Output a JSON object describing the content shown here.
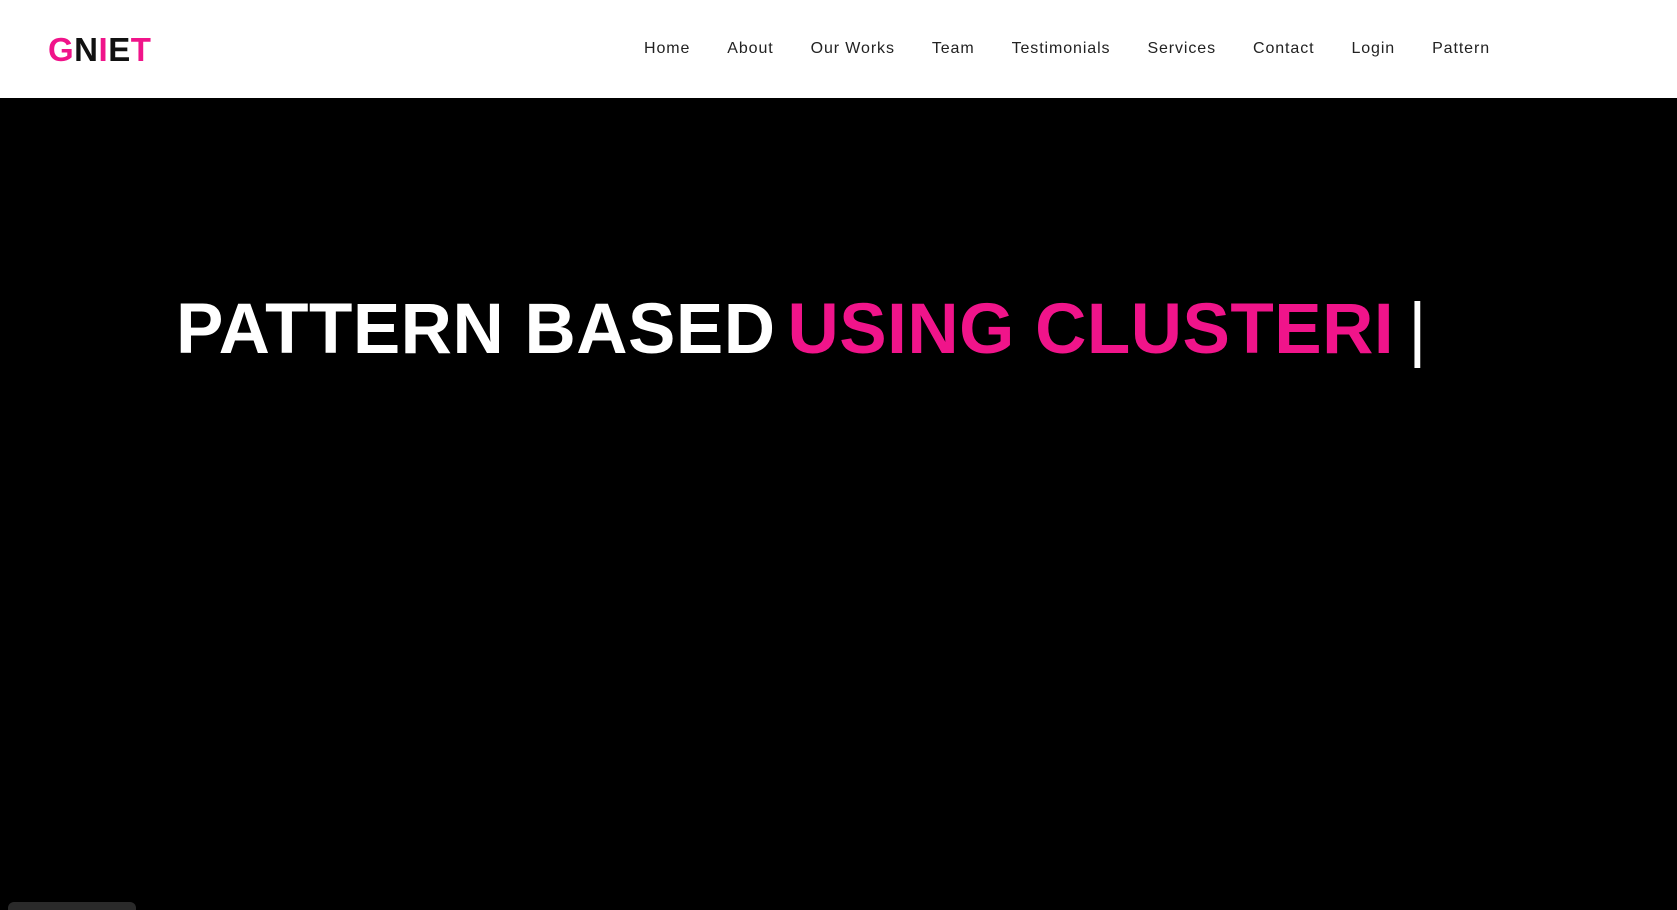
{
  "logo": {
    "letters": [
      {
        "char": "G",
        "color": "#f0148a"
      },
      {
        "char": "N",
        "color": "#111111"
      },
      {
        "char": "I",
        "color": "#f0148a"
      },
      {
        "char": "E",
        "color": "#111111"
      },
      {
        "char": "T",
        "color": "#f0148a"
      }
    ]
  },
  "nav": {
    "items": [
      "Home",
      "About",
      "Our Works",
      "Team",
      "Testimonials",
      "Services",
      "Contact",
      "Login",
      "Pattern"
    ]
  },
  "hero": {
    "static_text": "PATTERN BASED",
    "typed_text": "USING CLUSTERI",
    "cursor": "|"
  },
  "colors": {
    "accent": "#f0148a",
    "background": "#000000",
    "navbar": "#ffffff"
  }
}
